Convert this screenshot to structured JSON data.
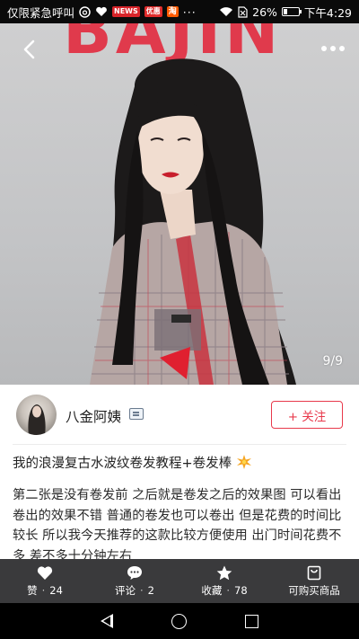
{
  "status_bar": {
    "carrier": "仅限紧急呼叫",
    "battery": "26%",
    "battery_level": 0.26,
    "time": "下午4:29",
    "more": "···",
    "app_badges": [
      {
        "icon": "netease-music-icon",
        "text": "",
        "color": "#ffffff"
      },
      {
        "icon": "health-heart-icon",
        "text": "",
        "color": "#ffffff"
      },
      {
        "icon": "news-app-icon",
        "text": "NEWS",
        "color": "#d8242a"
      },
      {
        "icon": "tmall-icon",
        "text": "优惠",
        "color": "#e02b2b"
      },
      {
        "icon": "taobao-icon",
        "text": "淘",
        "color": "#ff5a00"
      }
    ]
  },
  "hero": {
    "brand_text": "BAJIN",
    "page_indicator": "9/9",
    "back_icon": "chevron-left-icon",
    "more_icon": "more-dots-icon"
  },
  "author": {
    "name": "八金阿姨",
    "follow_label": "+ 关注"
  },
  "post": {
    "title": "我的浪漫复古水波纹卷发教程+卷发棒",
    "title_emoji": "sparkle-icon",
    "body": "第二张是没有卷发前 之后就是卷发之后的效果图 可以看出卷出的效果不错 普通的卷发也可以卷出 但是花费的时间比较长 所以我今天推荐的这款比较方便使用 出门时间花费不多 差不多十分钟左右"
  },
  "actions": [
    {
      "icon": "heart-icon",
      "label": "赞",
      "count": "24"
    },
    {
      "icon": "comment-icon",
      "label": "评论",
      "count": "2"
    },
    {
      "icon": "star-icon",
      "label": "收藏",
      "count": "78"
    },
    {
      "icon": "shopping-bag-icon",
      "label": "可购买商品",
      "count": ""
    }
  ],
  "colors": {
    "accent": "#e8394b",
    "action_bar": "#3a3a3c",
    "brand_red": "#e03a4c"
  }
}
